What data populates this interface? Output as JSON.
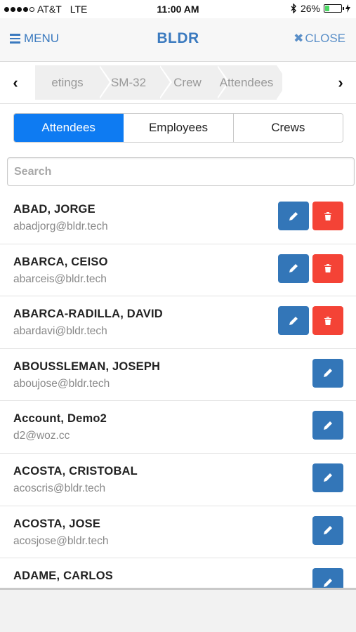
{
  "status_bar": {
    "carrier": "AT&T",
    "network": "LTE",
    "time": "11:00 AM",
    "battery_percent_text": "26%",
    "battery_level": 0.26,
    "battery_fill_color": "#4cd964"
  },
  "nav": {
    "menu_label": "MENU",
    "title": "BLDR",
    "close_label": "CLOSE",
    "accent_color": "#3b7abf"
  },
  "breadcrumb": {
    "items": [
      "Meetings",
      "SM-32",
      "Crew",
      "Attendees"
    ],
    "visible_first_fragment": "etings"
  },
  "tabs": {
    "items": [
      "Attendees",
      "Employees",
      "Crews"
    ],
    "active": "Attendees",
    "active_color": "#0e7bf2"
  },
  "search": {
    "placeholder": "Search",
    "value": ""
  },
  "people": [
    {
      "name": "ABAD, JORGE",
      "email": "abadjorg@bldr.tech",
      "deletable": true
    },
    {
      "name": "ABARCA, CEISO",
      "email": "abarceis@bldr.tech",
      "deletable": true
    },
    {
      "name": "ABARCA-RADILLA, DAVID",
      "email": "abardavi@bldr.tech",
      "deletable": true
    },
    {
      "name": "ABOUSSLEMAN, JOSEPH",
      "email": "aboujose@bldr.tech",
      "deletable": false
    },
    {
      "name": "Account, Demo2",
      "email": "d2@woz.cc",
      "deletable": false
    },
    {
      "name": "ACOSTA, CRISTOBAL",
      "email": "acoscris@bldr.tech",
      "deletable": false
    },
    {
      "name": "ACOSTA, JOSE",
      "email": "acosjose@bldr.tech",
      "deletable": false
    },
    {
      "name": "ADAME, CARLOS",
      "email": "",
      "deletable": false
    }
  ],
  "icons": {
    "edit": "pencil-icon",
    "delete": "trash-icon",
    "edit_button_color": "#3376b8",
    "delete_button_color": "#f44336"
  }
}
